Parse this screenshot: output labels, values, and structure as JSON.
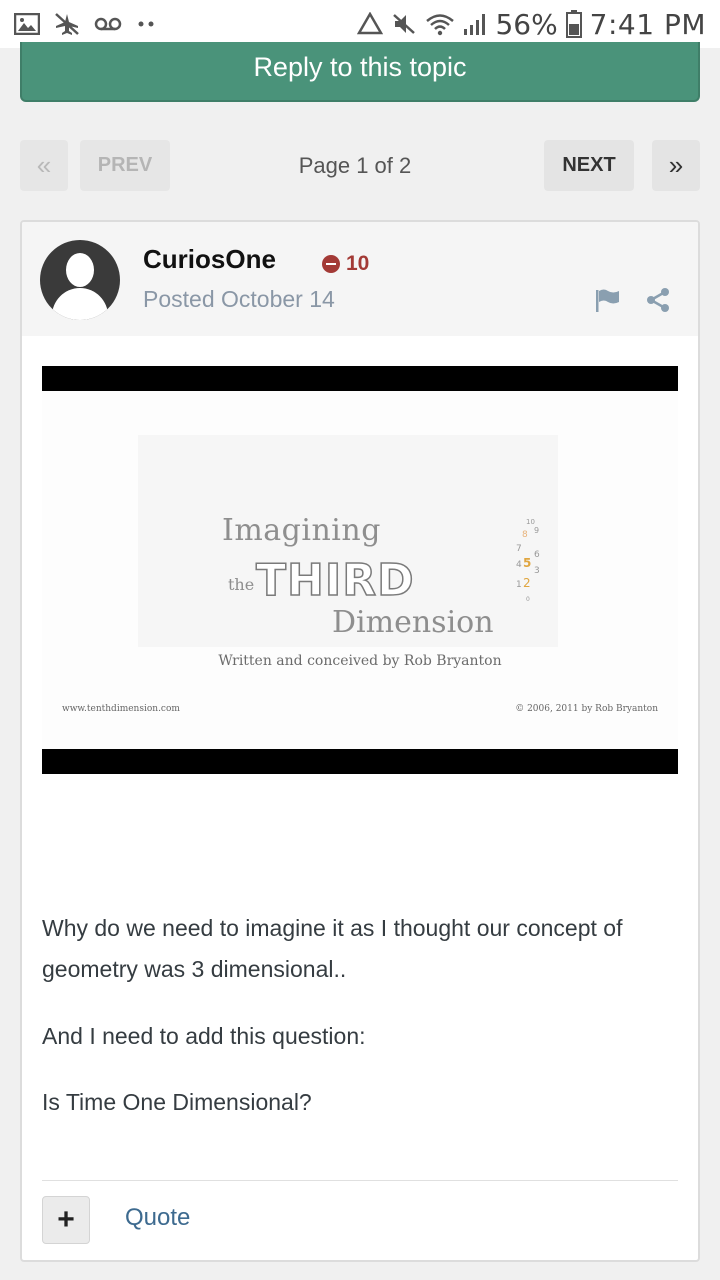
{
  "status_bar": {
    "battery": "56%",
    "time": "7:41 PM",
    "left_icons": [
      "image-icon",
      "airplane-off-icon",
      "voicemail-icon",
      "dots-icon"
    ],
    "right_icons": [
      "recycle-icon",
      "mute-icon",
      "wifi-icon",
      "signal-icon",
      "battery-icon"
    ]
  },
  "reply_button": {
    "label": "Reply to this topic"
  },
  "pagination": {
    "first_icon": "«",
    "prev_label": "PREV",
    "page_label": "Page 1 of 2",
    "next_label": "NEXT",
    "last_icon": "»"
  },
  "post": {
    "author": "CuriosOne",
    "reputation": "10",
    "posted": "Posted October 14",
    "video": {
      "title_line1": "Imagining",
      "title_the": "the",
      "title_third": "THIRD",
      "title_dimension": "Dimension",
      "credit": "Written and conceived by Rob Bryanton",
      "site": "www.tenthdimension.com",
      "copyright": "© 2006, 2011 by Rob Bryanton"
    },
    "body": {
      "paragraph_1": "Why do we need to imagine it as I thought our concept of geometry was 3 dimensional..",
      "paragraph_2": "And I need to add this question:",
      "paragraph_3": "Is Time One Dimensional?"
    },
    "actions": {
      "plus_label": "+",
      "quote_label": "Quote"
    }
  },
  "colors": {
    "accent_green": "#4a937a",
    "negative_rep": "#a33a36",
    "link_blue": "#3d6a8f"
  }
}
